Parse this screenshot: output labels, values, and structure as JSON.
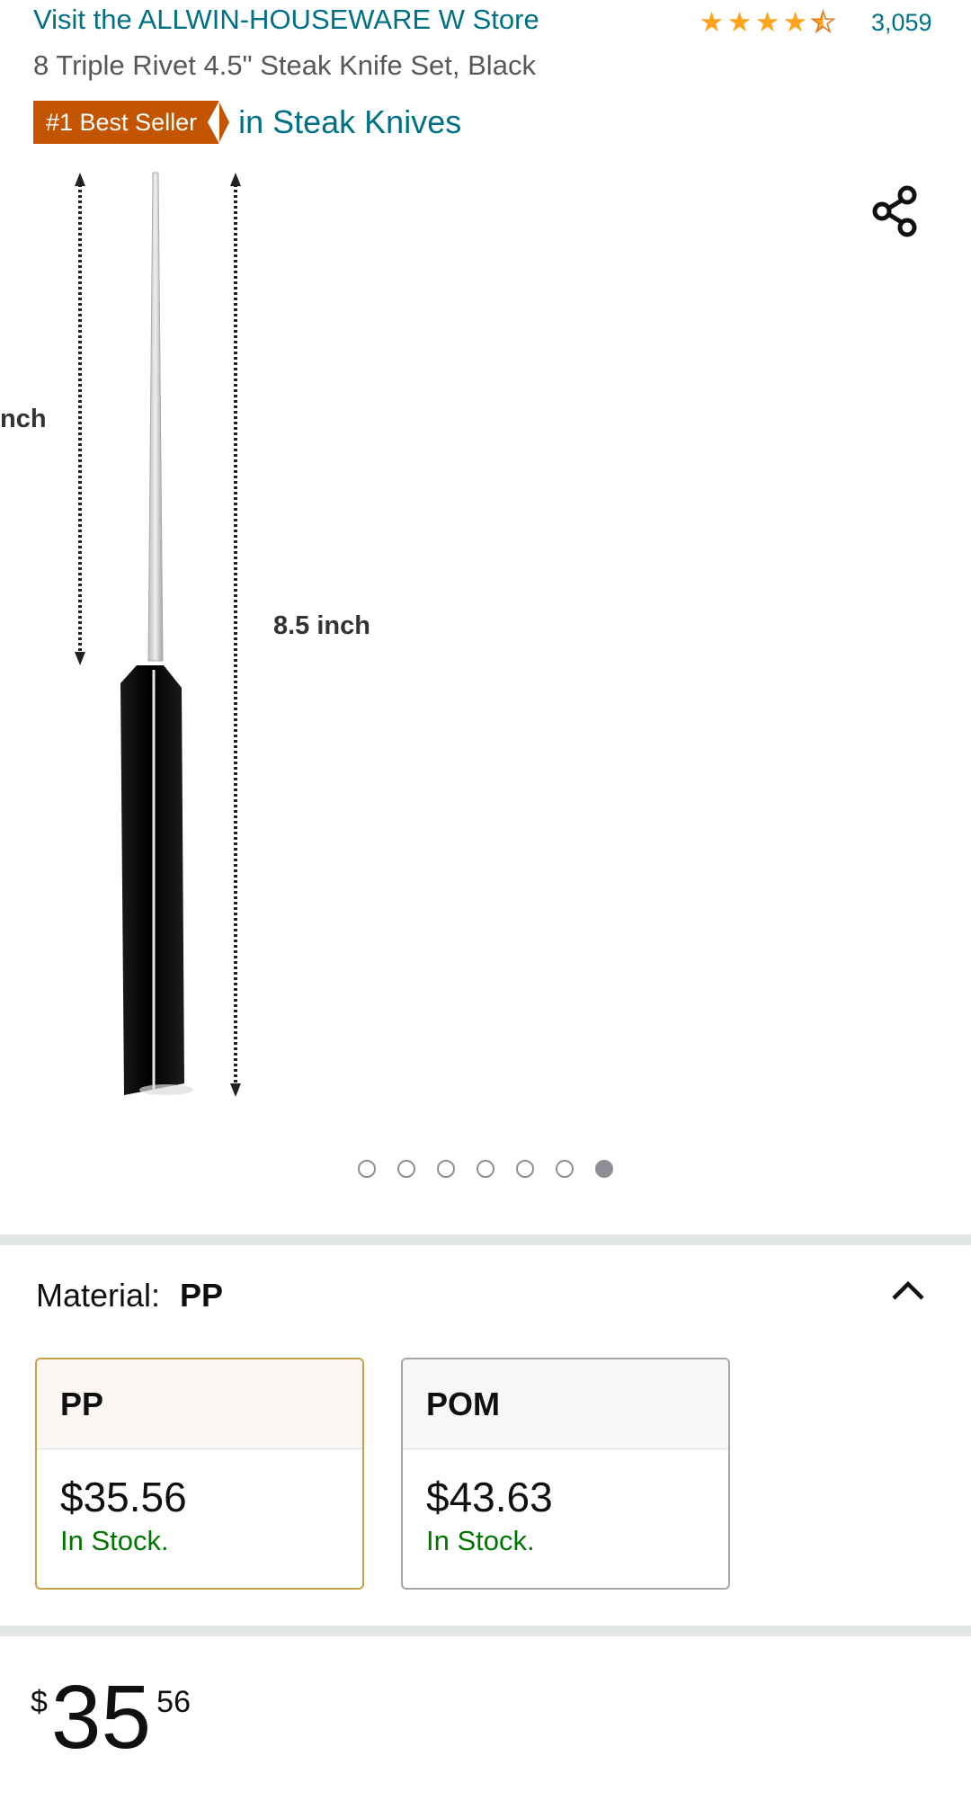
{
  "header": {
    "store_link": "Visit the ALLWIN-HOUSEWARE W Store",
    "rating": {
      "stars": 4.5,
      "review_count": "3,059"
    },
    "product_title": "8 Triple Rivet 4.5\" Steak Knife Set, Black",
    "badge": "#1 Best Seller",
    "badge_category": "in Steak Knives"
  },
  "gallery": {
    "measure_labels": {
      "left_partial": "nch",
      "total_length": "8.5 inch"
    },
    "dot_count": 7,
    "active_index": 6
  },
  "variation": {
    "label": "Material:",
    "selected": "PP",
    "options": [
      {
        "name": "PP",
        "price": "$35.56",
        "stock": "In Stock."
      },
      {
        "name": "POM",
        "price": "$43.63",
        "stock": "In Stock."
      }
    ]
  },
  "price": {
    "symbol": "$",
    "whole": "35",
    "fraction": "56"
  },
  "colors": {
    "link": "#007185",
    "badge": "#c45500",
    "star": "#ffa41c",
    "in_stock": "#007600",
    "selected_border": "#c7a04a"
  }
}
